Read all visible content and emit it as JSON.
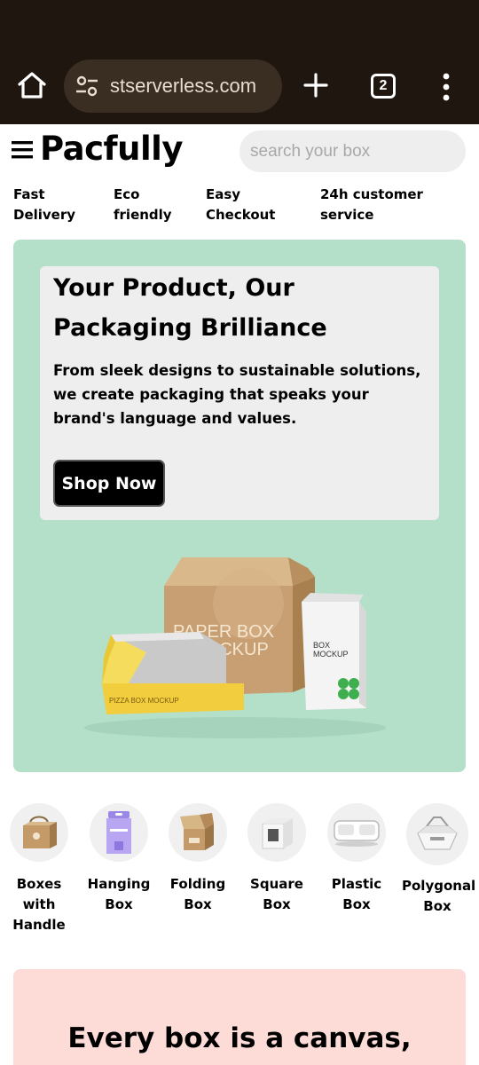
{
  "browser": {
    "url": "stserverless.com",
    "tab_count": "2"
  },
  "header": {
    "brand": "Pacfully",
    "search_placeholder": "search your box"
  },
  "features": [
    {
      "line1": "Fast",
      "line2": "Delivery"
    },
    {
      "line1": "Eco",
      "line2": "friendly"
    },
    {
      "line1": "Easy",
      "line2": "Checkout"
    },
    {
      "line1": "24h customer",
      "line2": "service"
    }
  ],
  "hero": {
    "title": "Your Product, Our Packaging Brilliance",
    "subtitle": "From sleek designs to sustainable solutions, we create packaging that speaks your brand's language and values.",
    "cta": "Shop Now",
    "art_text_1": "PAPER BOX",
    "art_text_2": "MOCKUP",
    "art_text_3": "BOX",
    "art_text_4": "MOCKUP",
    "art_text_5": "PIZZA BOX MOCKUP"
  },
  "categories": [
    {
      "label": "Boxes with Handle",
      "icon": "handle-box-icon"
    },
    {
      "label": "Hanging Box",
      "icon": "hanging-box-icon"
    },
    {
      "label": "Folding Box",
      "icon": "folding-box-icon"
    },
    {
      "label": "Square Box",
      "icon": "square-box-icon"
    },
    {
      "label": "Plastic Box",
      "icon": "plastic-box-icon"
    },
    {
      "label": "Polygonal Box",
      "icon": "polygonal-box-icon"
    }
  ],
  "promo": {
    "title": "Every box is a canvas,"
  },
  "colors": {
    "chrome_bg": "#1f1610",
    "hero_bg": "#b4e0c9",
    "promo_bg": "#fddbd6",
    "kraft": "#c9a074",
    "yellow": "#f4d03f"
  }
}
